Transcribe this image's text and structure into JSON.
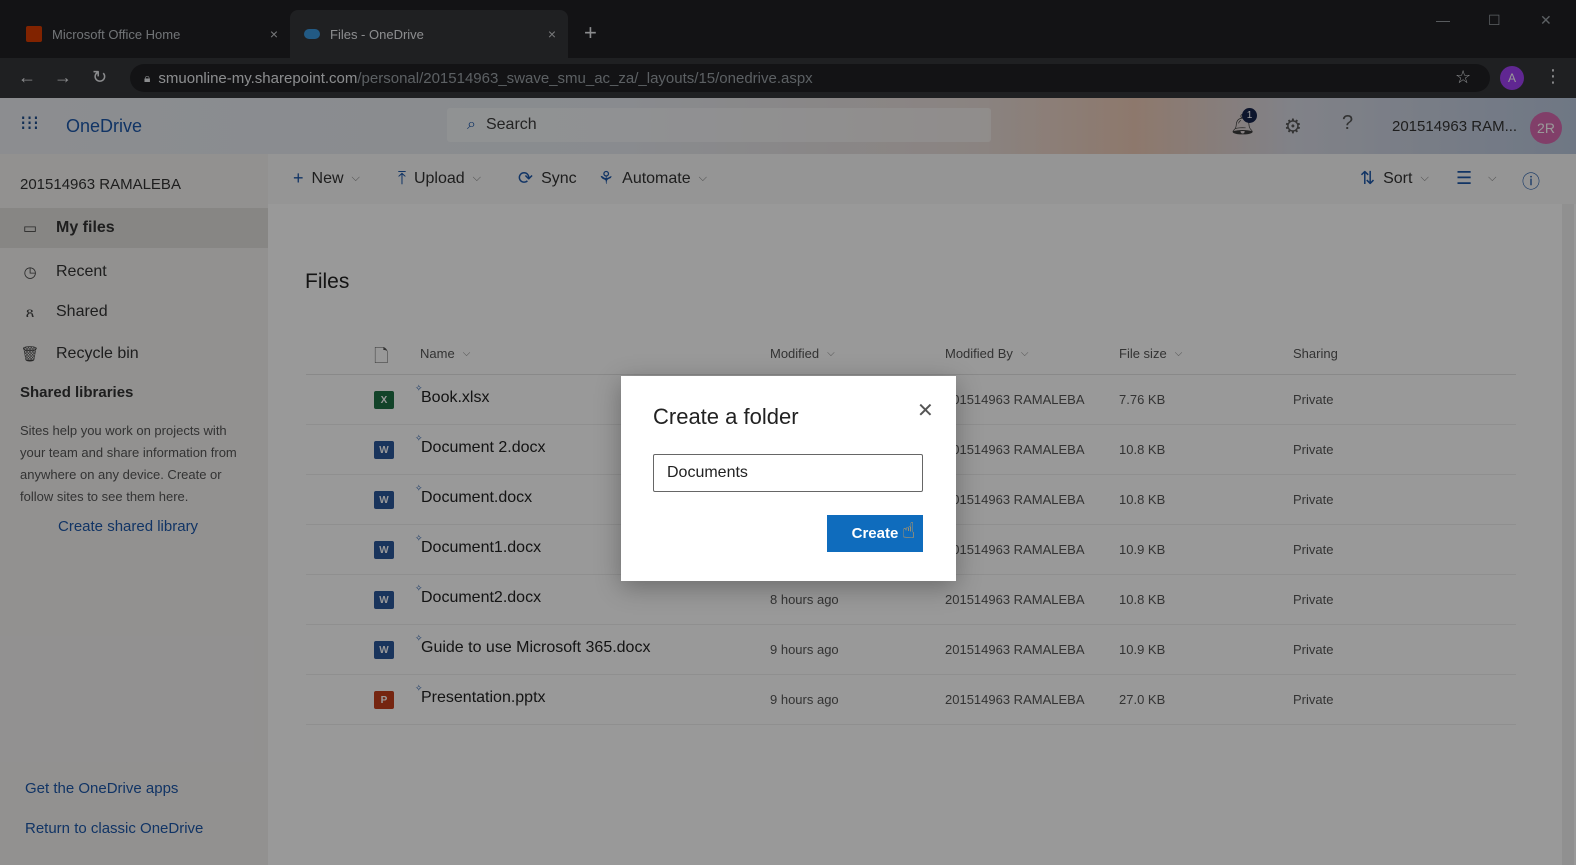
{
  "browser": {
    "tabs": [
      {
        "title": "Microsoft Office Home",
        "close": "×"
      },
      {
        "title": "Files - OneDrive",
        "close": "×"
      }
    ],
    "new_tab": "+",
    "url_host": "smuonline-my.sharepoint.com",
    "url_path": "/personal/201514963_swave_smu_ac_za/_layouts/15/onedrive.aspx",
    "profile_initial": "A"
  },
  "app": {
    "brand": "OneDrive",
    "search_label": "Search",
    "notification_count": "1",
    "username": "201514963 RAM...",
    "avatar_initials": "2R"
  },
  "leftnav": {
    "title": "201514963 RAMALEBA",
    "items": [
      {
        "label": "My files",
        "icon": "folder-icon"
      },
      {
        "label": "Recent",
        "icon": "clock-icon"
      },
      {
        "label": "Shared",
        "icon": "people-icon"
      },
      {
        "label": "Recycle bin",
        "icon": "trash-icon"
      }
    ],
    "shared_libraries_title": "Shared libraries",
    "shared_libraries_desc": "Sites help you work on projects with your team and share information from anywhere on any device. Create or follow sites to see them here.",
    "create_shared_library": "Create shared library",
    "get_apps": "Get the OneDrive apps",
    "return_classic": "Return to classic OneDrive"
  },
  "commandbar": {
    "new": "New",
    "upload": "Upload",
    "sync": "Sync",
    "automate": "Automate",
    "sort": "Sort"
  },
  "main": {
    "title": "Files",
    "columns": {
      "name": "Name",
      "modified": "Modified",
      "modified_by": "Modified By",
      "file_size": "File size",
      "sharing": "Sharing"
    },
    "rows": [
      {
        "name": "Book.xlsx",
        "type": "xl",
        "type_label": "X",
        "modified": "",
        "modified_by": "201514963 RAMALEBA",
        "size": "7.76 KB",
        "sharing": "Private"
      },
      {
        "name": "Document 2.docx",
        "type": "wd",
        "type_label": "W",
        "modified": "",
        "modified_by": "201514963 RAMALEBA",
        "size": "10.8 KB",
        "sharing": "Private"
      },
      {
        "name": "Document.docx",
        "type": "wd",
        "type_label": "W",
        "modified": "",
        "modified_by": "201514963 RAMALEBA",
        "size": "10.8 KB",
        "sharing": "Private"
      },
      {
        "name": "Document1.docx",
        "type": "wd",
        "type_label": "W",
        "modified": "",
        "modified_by": "201514963 RAMALEBA",
        "size": "10.9 KB",
        "sharing": "Private"
      },
      {
        "name": "Document2.docx",
        "type": "wd",
        "type_label": "W",
        "modified": "8 hours ago",
        "modified_by": "201514963 RAMALEBA",
        "size": "10.8 KB",
        "sharing": "Private"
      },
      {
        "name": "Guide to use Microsoft 365.docx",
        "type": "wd",
        "type_label": "W",
        "modified": "9 hours ago",
        "modified_by": "201514963 RAMALEBA",
        "size": "10.9 KB",
        "sharing": "Private"
      },
      {
        "name": "Presentation.pptx",
        "type": "pp",
        "type_label": "P",
        "modified": "9 hours ago",
        "modified_by": "201514963 RAMALEBA",
        "size": "27.0 KB",
        "sharing": "Private"
      }
    ]
  },
  "dialog": {
    "title": "Create a folder",
    "input_value": "Documents",
    "create_label": "Create"
  }
}
